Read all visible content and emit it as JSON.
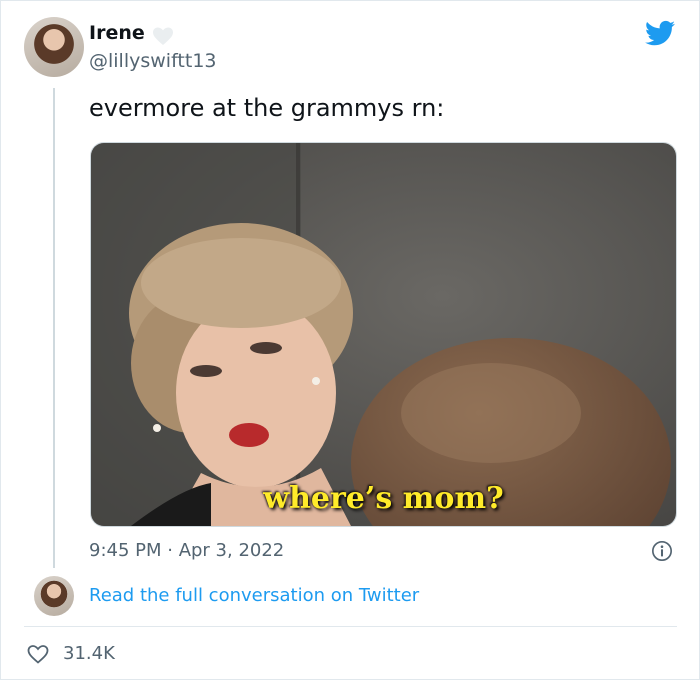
{
  "tweet": {
    "author_name": "Irene",
    "author_handle": "@lillyswiftt13",
    "text": "evermore at the grammys rn:",
    "media_caption": "where’s mom?",
    "timestamp": "9:45 PM · Apr 3, 2022",
    "read_full_conversation": "Read the full conversation on Twitter",
    "like_count": "31.4K"
  },
  "icons": {
    "brand": "twitter-bird-icon",
    "badge": "heart-icon",
    "info": "info-icon",
    "like": "heart-outline-icon"
  },
  "colors": {
    "twitter_blue": "#1d9bf0",
    "caption_yellow": "#ffeb2a",
    "secondary_text": "#536471"
  }
}
